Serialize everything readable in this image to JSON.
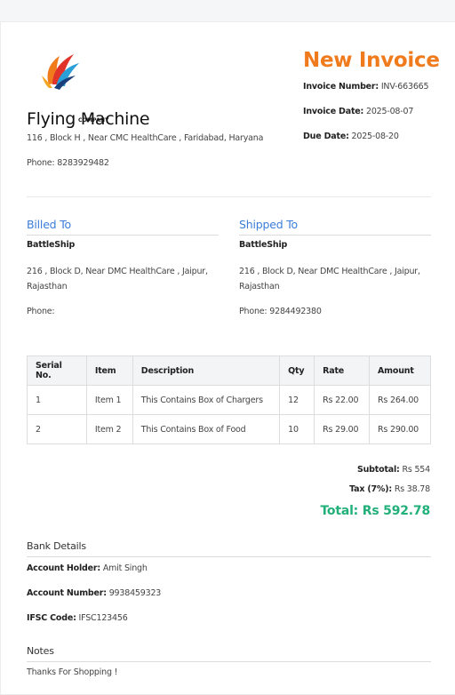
{
  "company": {
    "logo_text": "COMPANY",
    "name": "Flying Machine",
    "address": "116 , Block H , Near CMC HealthCare , Faridabad, Haryana",
    "phone_label": "Phone:",
    "phone": "8283929482"
  },
  "invoice": {
    "title": "New Invoice",
    "number_label": "Invoice Number:",
    "number": "INV-663665",
    "date_label": "Invoice Date:",
    "date": "2025-08-07",
    "due_label": "Due Date:",
    "due": "2025-08-20"
  },
  "billed_to": {
    "heading": "Billed To",
    "name": "BattleShip",
    "address": "216 , Block D, Near DMC HealthCare , Jaipur, Rajasthan",
    "phone_label": "Phone:",
    "phone": ""
  },
  "shipped_to": {
    "heading": "Shipped To",
    "name": "BattleShip",
    "address": "216 , Block D, Near DMC HealthCare , Jaipur, Rajasthan",
    "phone_label": "Phone:",
    "phone": "9284492380"
  },
  "items_table": {
    "headers": [
      "Serial No.",
      "Item",
      "Description",
      "Qty",
      "Rate",
      "Amount"
    ],
    "rows": [
      [
        "1",
        "Item 1",
        "This Contains Box of Chargers",
        "12",
        "Rs 22.00",
        "Rs 264.00"
      ],
      [
        "2",
        "Item 2",
        "This Contains Box of Food",
        "10",
        "Rs 29.00",
        "Rs 290.00"
      ]
    ]
  },
  "totals": {
    "subtotal_label": "Subtotal:",
    "subtotal": "Rs 554",
    "tax_label": "Tax (7%):",
    "tax": "Rs 38.78",
    "total_label": "Total:",
    "total": "Rs 592.78"
  },
  "bank": {
    "heading": "Bank Details",
    "holder_label": "Account Holder:",
    "holder": "Amit Singh",
    "number_label": "Account Number:",
    "number": "9938459323",
    "ifsc_label": "IFSC Code:",
    "ifsc": "IFSC123456"
  },
  "notes": {
    "heading": "Notes",
    "text": "Thanks For Shopping !"
  },
  "colors": {
    "title_orange": "#f07b1d",
    "heading_blue": "#3b7dd8",
    "total_green": "#22b07a"
  }
}
